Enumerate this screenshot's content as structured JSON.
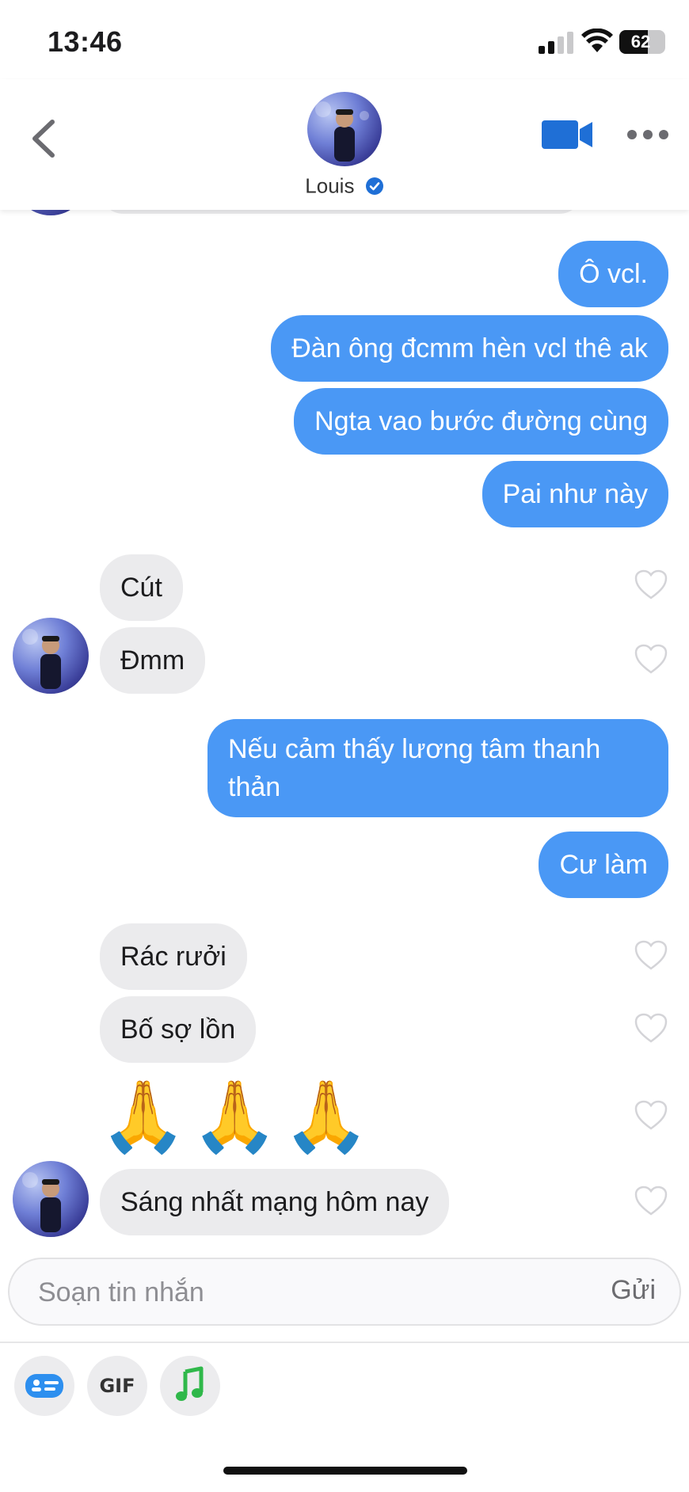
{
  "status_bar": {
    "time": "13:46",
    "battery": "62",
    "battery_level": 0.62
  },
  "header": {
    "contact_name": "Louis",
    "verified": true,
    "icons": [
      "chevron-left-icon",
      "video-camera-icon",
      "more-icon",
      "verified-icon"
    ]
  },
  "messages": [
    {
      "direction": "out",
      "text": "Ô vcl."
    },
    {
      "direction": "out",
      "text": "Đàn ông đcmm hèn vcl thê ak"
    },
    {
      "direction": "out",
      "text": "Ngta vao bước đường cùng"
    },
    {
      "direction": "out",
      "text": "Pai như này"
    },
    {
      "direction": "in",
      "text": "Cút"
    },
    {
      "direction": "in",
      "text": "Đmm"
    },
    {
      "direction": "out",
      "text": "Nếu cảm thấy lương tâm thanh thản"
    },
    {
      "direction": "out",
      "text": "Cư làm"
    },
    {
      "direction": "in",
      "text": "Rác rưởi"
    },
    {
      "direction": "in",
      "text": "Bố sợ lồn"
    },
    {
      "direction": "in",
      "text": "🙏🙏🙏"
    },
    {
      "direction": "in",
      "text": "Sáng nhất mạng hôm nay"
    }
  ],
  "compose": {
    "placeholder": "Soạn tin nhắn",
    "send_label": "Gửi"
  },
  "toolbar": {
    "sticker_icon": "sticker-card-icon",
    "gif_label": "GIF",
    "music_icon": "music-note-icon"
  },
  "colors": {
    "outgoing_bubble": "#4a98f5",
    "incoming_bubble": "#ebebed",
    "accent": "#1f6fd6",
    "music_green": "#2fb84a"
  }
}
